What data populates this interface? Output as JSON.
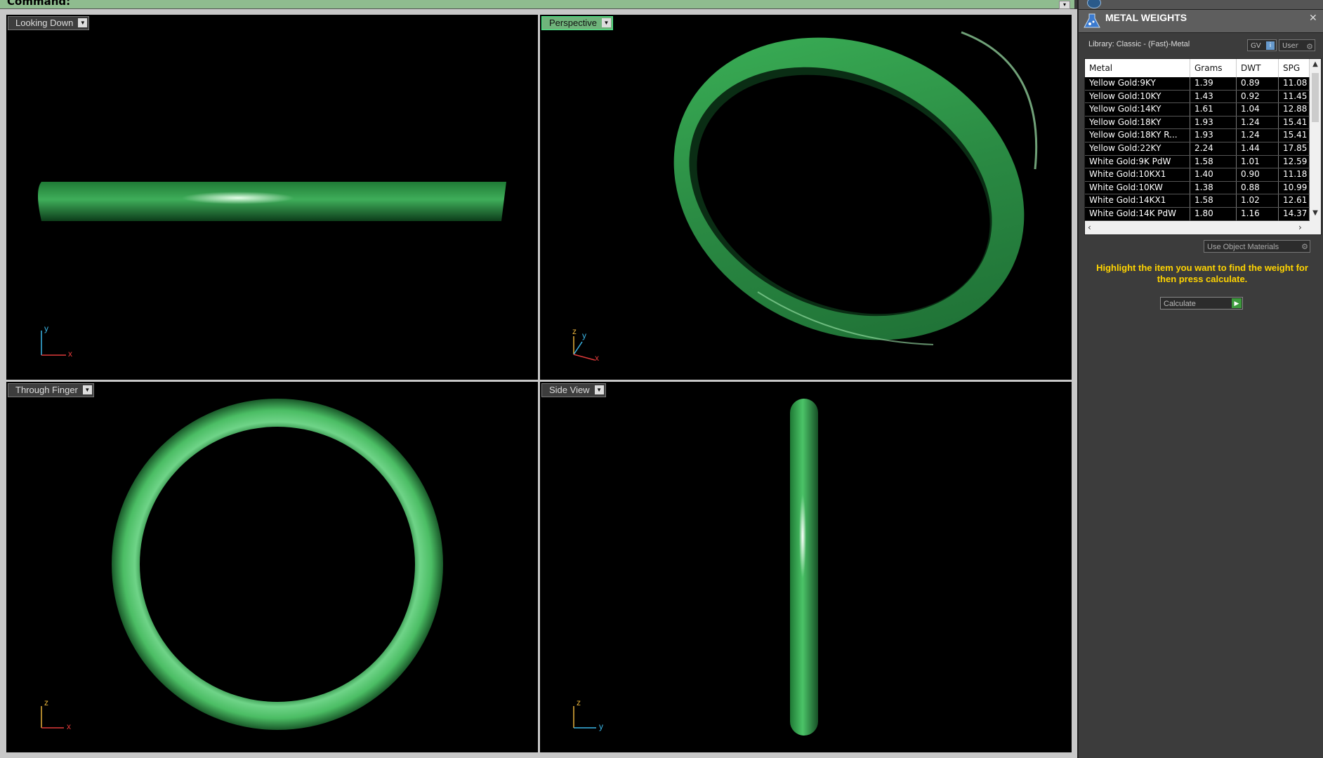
{
  "command": {
    "label": "Command:"
  },
  "viewports": {
    "top_left": {
      "label": "Looking Down",
      "axes": [
        "y",
        "x"
      ]
    },
    "top_right": {
      "label": "Perspective",
      "axes": [
        "z",
        "y",
        "x"
      ]
    },
    "bottom_left": {
      "label": "Through Finger",
      "axes": [
        "z",
        "x"
      ]
    },
    "bottom_right": {
      "label": "Side View",
      "axes": [
        "z",
        "y"
      ]
    }
  },
  "panel": {
    "title": "METAL WEIGHTS",
    "library": "Library: Classic - (Fast)-Metal",
    "gv_label": "GV",
    "user_label": "User",
    "columns": [
      "Metal",
      "Grams",
      "DWT",
      "SPG"
    ],
    "rows": [
      [
        "Yellow Gold:9KY",
        "1.39",
        "0.89",
        "11.08"
      ],
      [
        "Yellow Gold:10KY",
        "1.43",
        "0.92",
        "11.45"
      ],
      [
        "Yellow Gold:14KY",
        "1.61",
        "1.04",
        "12.88"
      ],
      [
        "Yellow Gold:18KY",
        "1.93",
        "1.24",
        "15.41"
      ],
      [
        "Yellow Gold:18KY R...",
        "1.93",
        "1.24",
        "15.41"
      ],
      [
        "Yellow Gold:22KY",
        "2.24",
        "1.44",
        "17.85"
      ],
      [
        "White Gold:9K PdW",
        "1.58",
        "1.01",
        "12.59"
      ],
      [
        "White Gold:10KX1",
        "1.40",
        "0.90",
        "11.18"
      ],
      [
        "White Gold:10KW",
        "1.38",
        "0.88",
        "10.99"
      ],
      [
        "White Gold:14KX1",
        "1.58",
        "1.02",
        "12.61"
      ],
      [
        "White Gold:14K PdW",
        "1.80",
        "1.16",
        "14.37"
      ]
    ],
    "use_object_materials": "Use Object Materials",
    "hint": "Highlight the item you want to find the weight for then press calculate.",
    "calculate": "Calculate"
  },
  "colors": {
    "ring": "#3fa85a",
    "active_tab": "#6fb47b",
    "hint": "#ffd400"
  }
}
